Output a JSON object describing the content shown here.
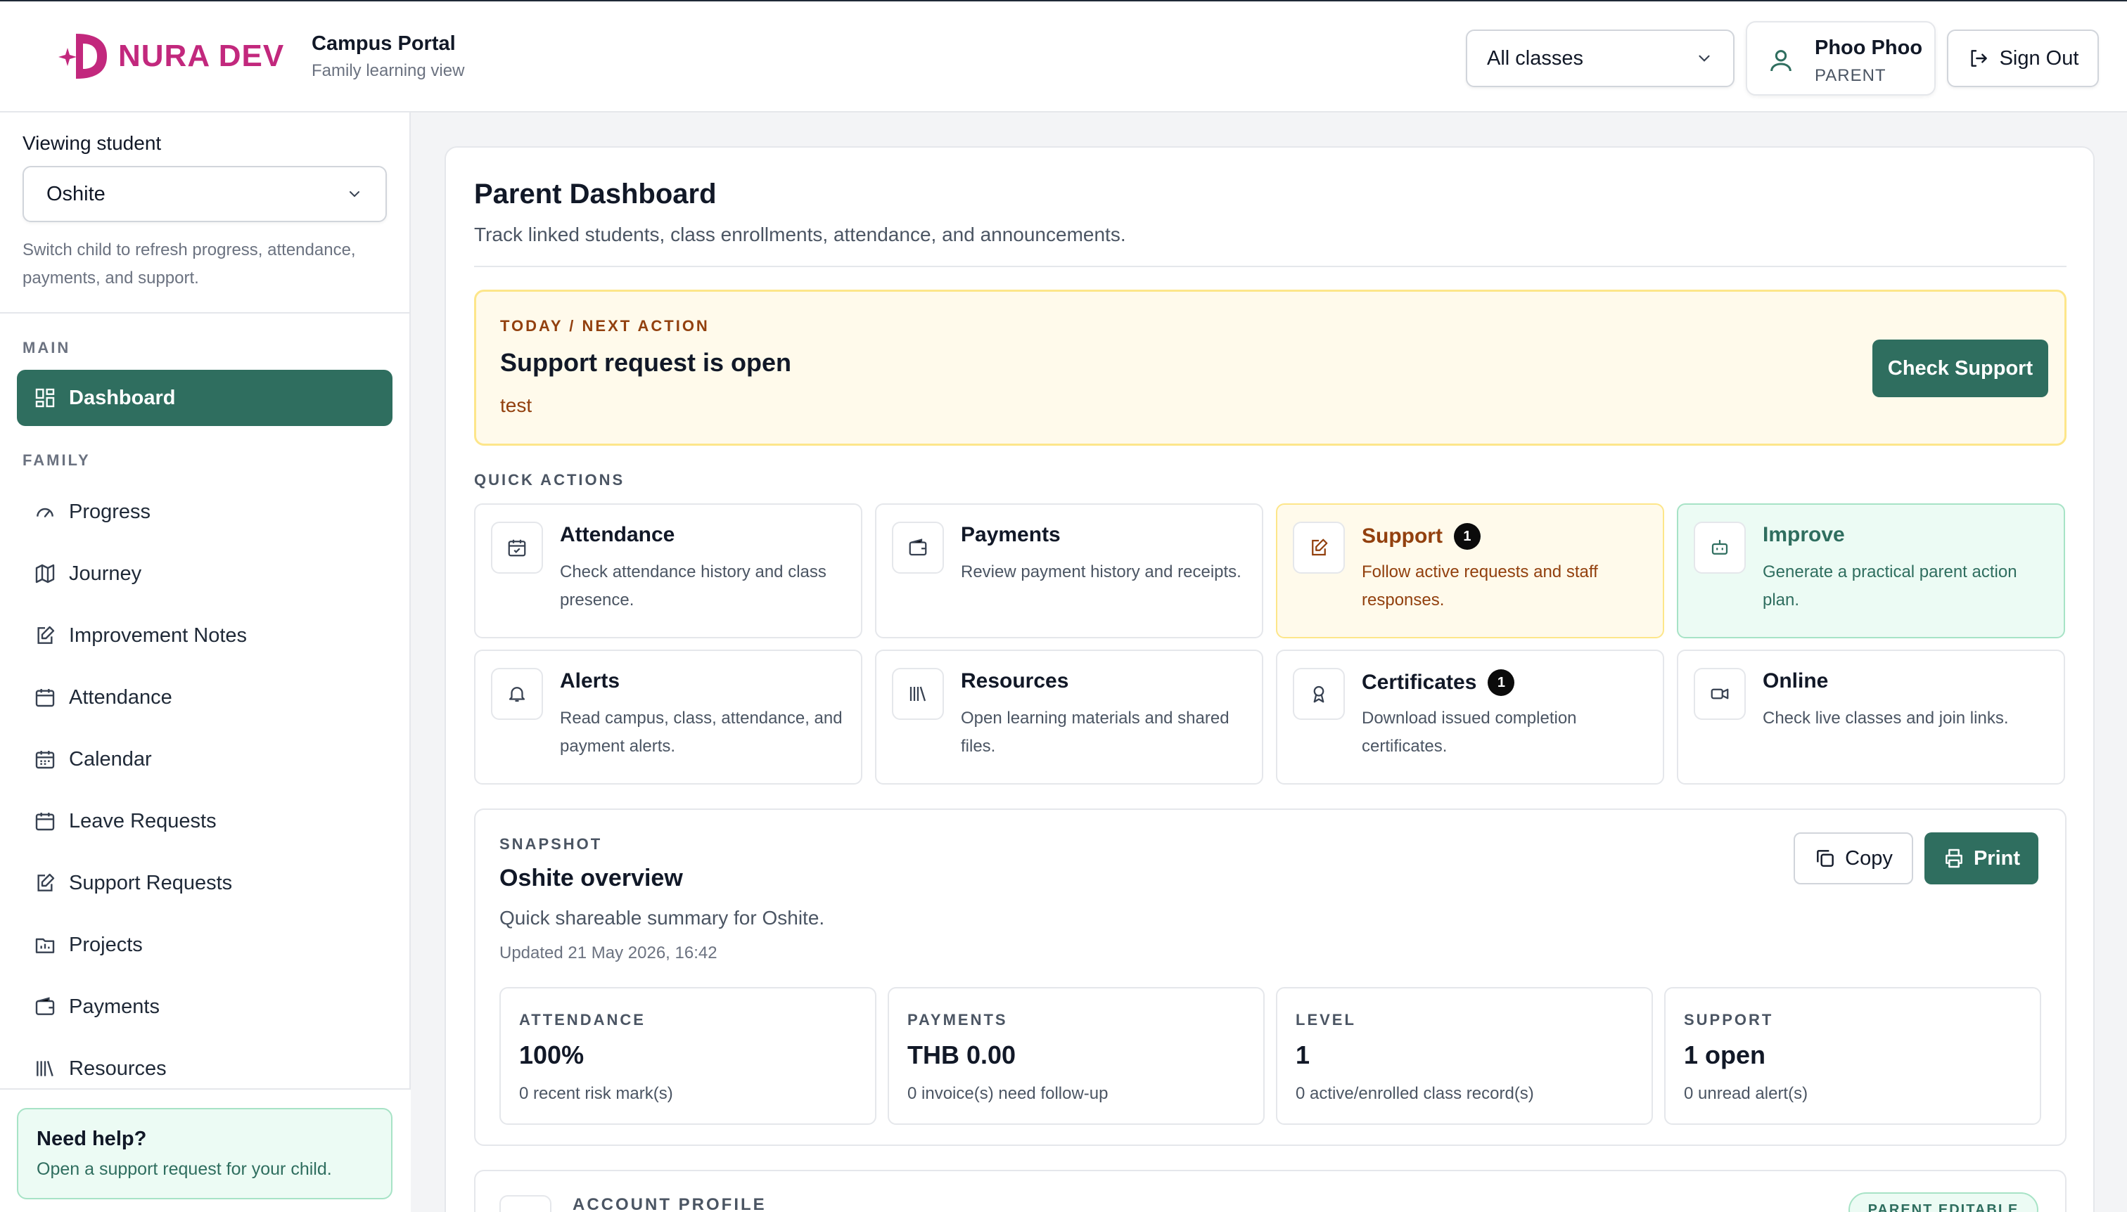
{
  "brand": {
    "logo_text": "NURA DEV",
    "accent": "#c2287d",
    "primary": "#2f6e5f"
  },
  "header": {
    "portal_title": "Campus Portal",
    "portal_subtitle": "Family learning view",
    "class_filter": "All classes",
    "user_name": "Phoo Phoo",
    "user_role": "PARENT",
    "sign_out": "Sign Out"
  },
  "sidebar": {
    "viewing_label": "Viewing student",
    "student_selected": "Oshite",
    "switch_note": "Switch child to refresh progress, attendance, payments, and support.",
    "section_main": "MAIN",
    "section_family": "FAMILY",
    "items": [
      {
        "label": "Dashboard",
        "icon": "dashboard-icon",
        "active": true
      },
      {
        "label": "Progress",
        "icon": "gauge-icon"
      },
      {
        "label": "Journey",
        "icon": "map-icon"
      },
      {
        "label": "Improvement Notes",
        "icon": "note-edit-icon"
      },
      {
        "label": "Attendance",
        "icon": "calendar-check-icon"
      },
      {
        "label": "Calendar",
        "icon": "calendar-icon"
      },
      {
        "label": "Leave Requests",
        "icon": "calendar-leave-icon"
      },
      {
        "label": "Support Requests",
        "icon": "support-edit-icon"
      },
      {
        "label": "Projects",
        "icon": "folder-icon"
      },
      {
        "label": "Payments",
        "icon": "wallet-icon"
      },
      {
        "label": "Resources",
        "icon": "library-icon"
      }
    ],
    "help_title": "Need help?",
    "help_sub": "Open a support request for your child."
  },
  "main": {
    "title": "Parent Dashboard",
    "subtitle": "Track linked students, class enrollments, attendance, and announcements.",
    "next_action": {
      "eyebrow": "TODAY / NEXT ACTION",
      "title": "Support request is open",
      "description": "test",
      "button": "Check Support"
    },
    "quick_actions_label": "QUICK ACTIONS",
    "quick_actions": [
      {
        "title": "Attendance",
        "desc": "Check attendance history and class presence.",
        "icon": "calendar-check-icon",
        "badge": null
      },
      {
        "title": "Payments",
        "desc": "Review payment history and receipts.",
        "icon": "wallet-icon",
        "badge": null
      },
      {
        "title": "Support",
        "desc": "Follow active requests and staff responses.",
        "icon": "support-edit-icon",
        "badge": "1"
      },
      {
        "title": "Improve",
        "desc": "Generate a practical parent action plan.",
        "icon": "robot-icon",
        "badge": null
      },
      {
        "title": "Alerts",
        "desc": "Read campus, class, attendance, and payment alerts.",
        "icon": "bell-icon",
        "badge": null
      },
      {
        "title": "Resources",
        "desc": "Open learning materials and shared files.",
        "icon": "library-icon",
        "badge": null
      },
      {
        "title": "Certificates",
        "desc": "Download issued completion certificates.",
        "icon": "award-icon",
        "badge": "1"
      },
      {
        "title": "Online",
        "desc": "Check live classes and join links.",
        "icon": "video-icon",
        "badge": null
      }
    ],
    "snapshot": {
      "eyebrow": "SNAPSHOT",
      "title": "Oshite overview",
      "subtitle": "Quick shareable summary for Oshite.",
      "updated": "Updated 21 May 2026, 16:42",
      "copy": "Copy",
      "print": "Print",
      "stats": [
        {
          "label": "ATTENDANCE",
          "value": "100%",
          "note": "0 recent risk mark(s)"
        },
        {
          "label": "PAYMENTS",
          "value": "THB 0.00",
          "note": "0 invoice(s) need follow-up"
        },
        {
          "label": "LEVEL",
          "value": "1",
          "note": "0 active/enrolled class record(s)"
        },
        {
          "label": "SUPPORT",
          "value": "1 open",
          "note": "0 unread alert(s)"
        }
      ]
    },
    "account": {
      "label": "ACCOUNT PROFILE",
      "badge": "PARENT EDITABLE"
    }
  }
}
